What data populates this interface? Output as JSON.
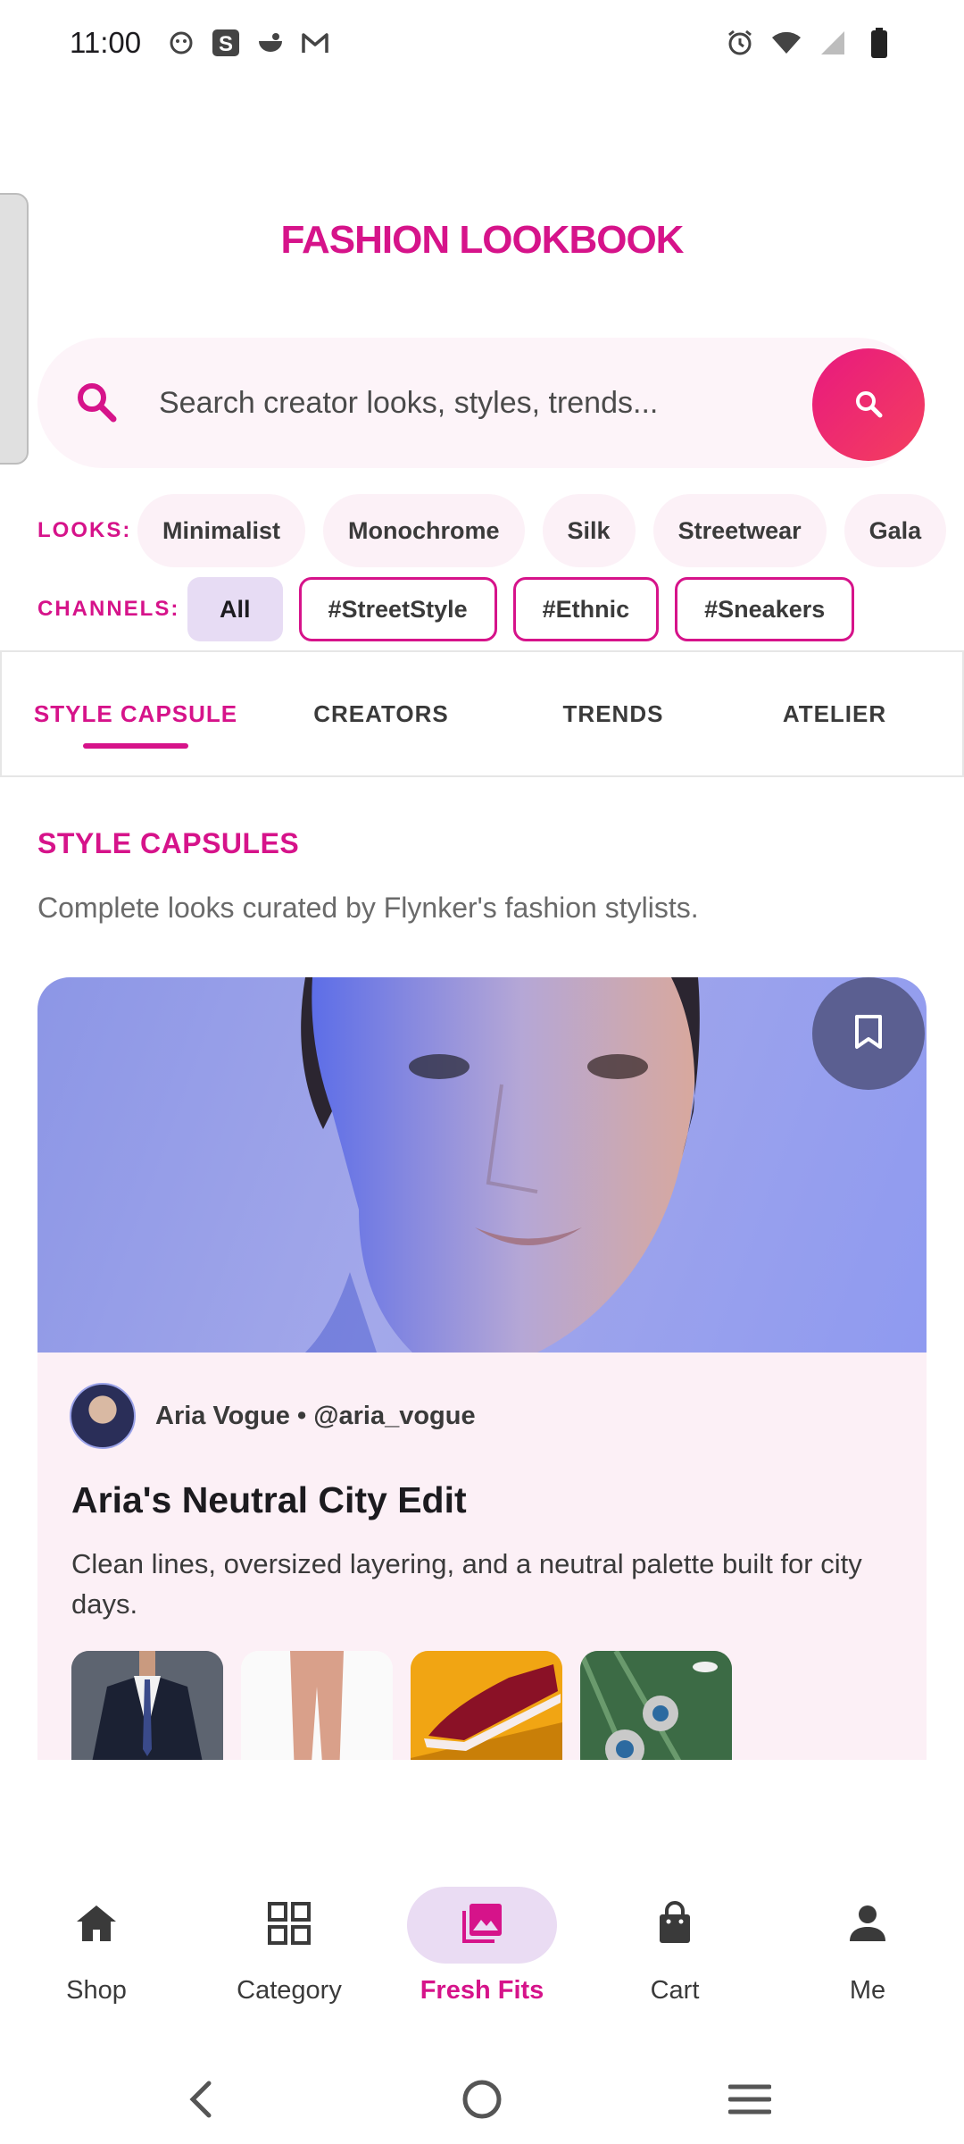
{
  "status_bar": {
    "time": "11:00",
    "left_icons": [
      "smiley-icon",
      "s-app-icon",
      "bowl-icon",
      "gmail-icon"
    ],
    "right_icons": [
      "alarm-icon",
      "wifi-icon",
      "signal-icon",
      "battery-icon"
    ]
  },
  "header": {
    "title": "FASHION LOOKBOOK"
  },
  "search": {
    "placeholder": "Search creator looks, styles, trends..."
  },
  "looks": {
    "label": "LOOKS:",
    "chips": [
      "Minimalist",
      "Monochrome",
      "Silk",
      "Streetwear",
      "Gala"
    ]
  },
  "channels": {
    "label": "CHANNELS:",
    "chips": [
      "All",
      "#StreetStyle",
      "#Ethnic",
      "#Sneakers"
    ],
    "selected": "All"
  },
  "tabs": {
    "items": [
      "STYLE CAPSULE",
      "CREATORS",
      "TRENDS",
      "ATELIER"
    ],
    "active": "STYLE CAPSULE"
  },
  "section": {
    "title": "STYLE CAPSULES",
    "description": "Complete looks curated by Flynker's fashion stylists."
  },
  "card": {
    "creator": "Aria Vogue • @aria_vogue",
    "title": "Aria's Neutral City Edit",
    "description": "Clean lines, oversized layering, and a neutral palette built for city days.",
    "thumbnails": [
      "suit",
      "pink-trousers",
      "sneaker",
      "earrings"
    ]
  },
  "bottom_nav": {
    "items": [
      "Shop",
      "Category",
      "Fresh Fits",
      "Cart",
      "Me"
    ],
    "active": "Fresh Fits"
  },
  "colors": {
    "accent": "#d6138a",
    "accent_gradient_end": "#f43f5e",
    "chip_bg": "#fcf1f7",
    "selected_chip_bg": "#e7dcf4",
    "card_bg": "#fcf0f6",
    "bookmark_bg": "#5b5f91"
  }
}
